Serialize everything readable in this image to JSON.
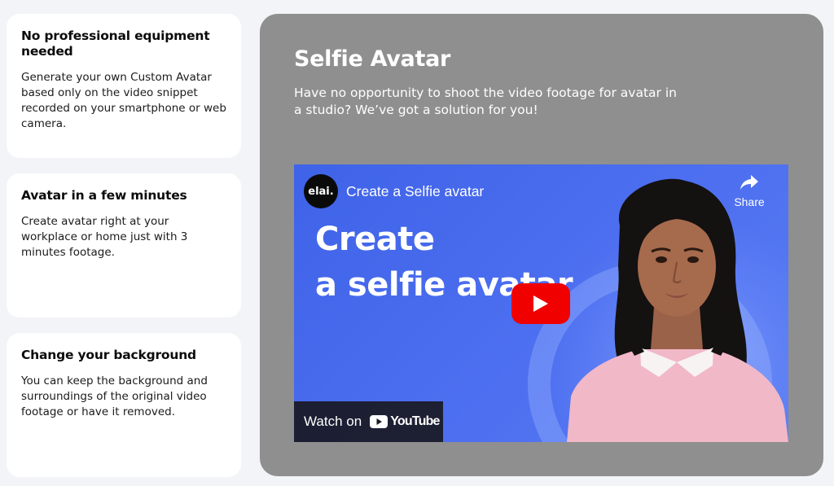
{
  "features": [
    {
      "title": "No professional equipment needed",
      "text": "Generate your own Custom Avatar based only on the video snippet recorded on your smartphone or web camera."
    },
    {
      "title": "Avatar in a few minutes",
      "text": "Create avatar right at your workplace or home just with 3 minutes footage."
    },
    {
      "title": "Change your background",
      "text": "You can keep the background and surroundings of the original video footage or have it removed."
    }
  ],
  "panel": {
    "title": "Selfie Avatar",
    "subtitle": "Have no opportunity to shoot the video footage for avatar in a studio? We’ve got a solution for you!"
  },
  "video": {
    "channel_logo": "elai.",
    "title": "Create a Selfie avatar",
    "share_label": "Share",
    "thumbnail_line1": "Create",
    "thumbnail_line2": "a selfie avatar",
    "watch_on_label": "Watch on",
    "youtube_brand": "YouTube",
    "icons": {
      "share": "share-arrow-icon",
      "play": "play-icon",
      "youtube": "youtube-logo-icon"
    },
    "colors": {
      "background": "#4566ec",
      "play_button": "#f10000"
    }
  }
}
